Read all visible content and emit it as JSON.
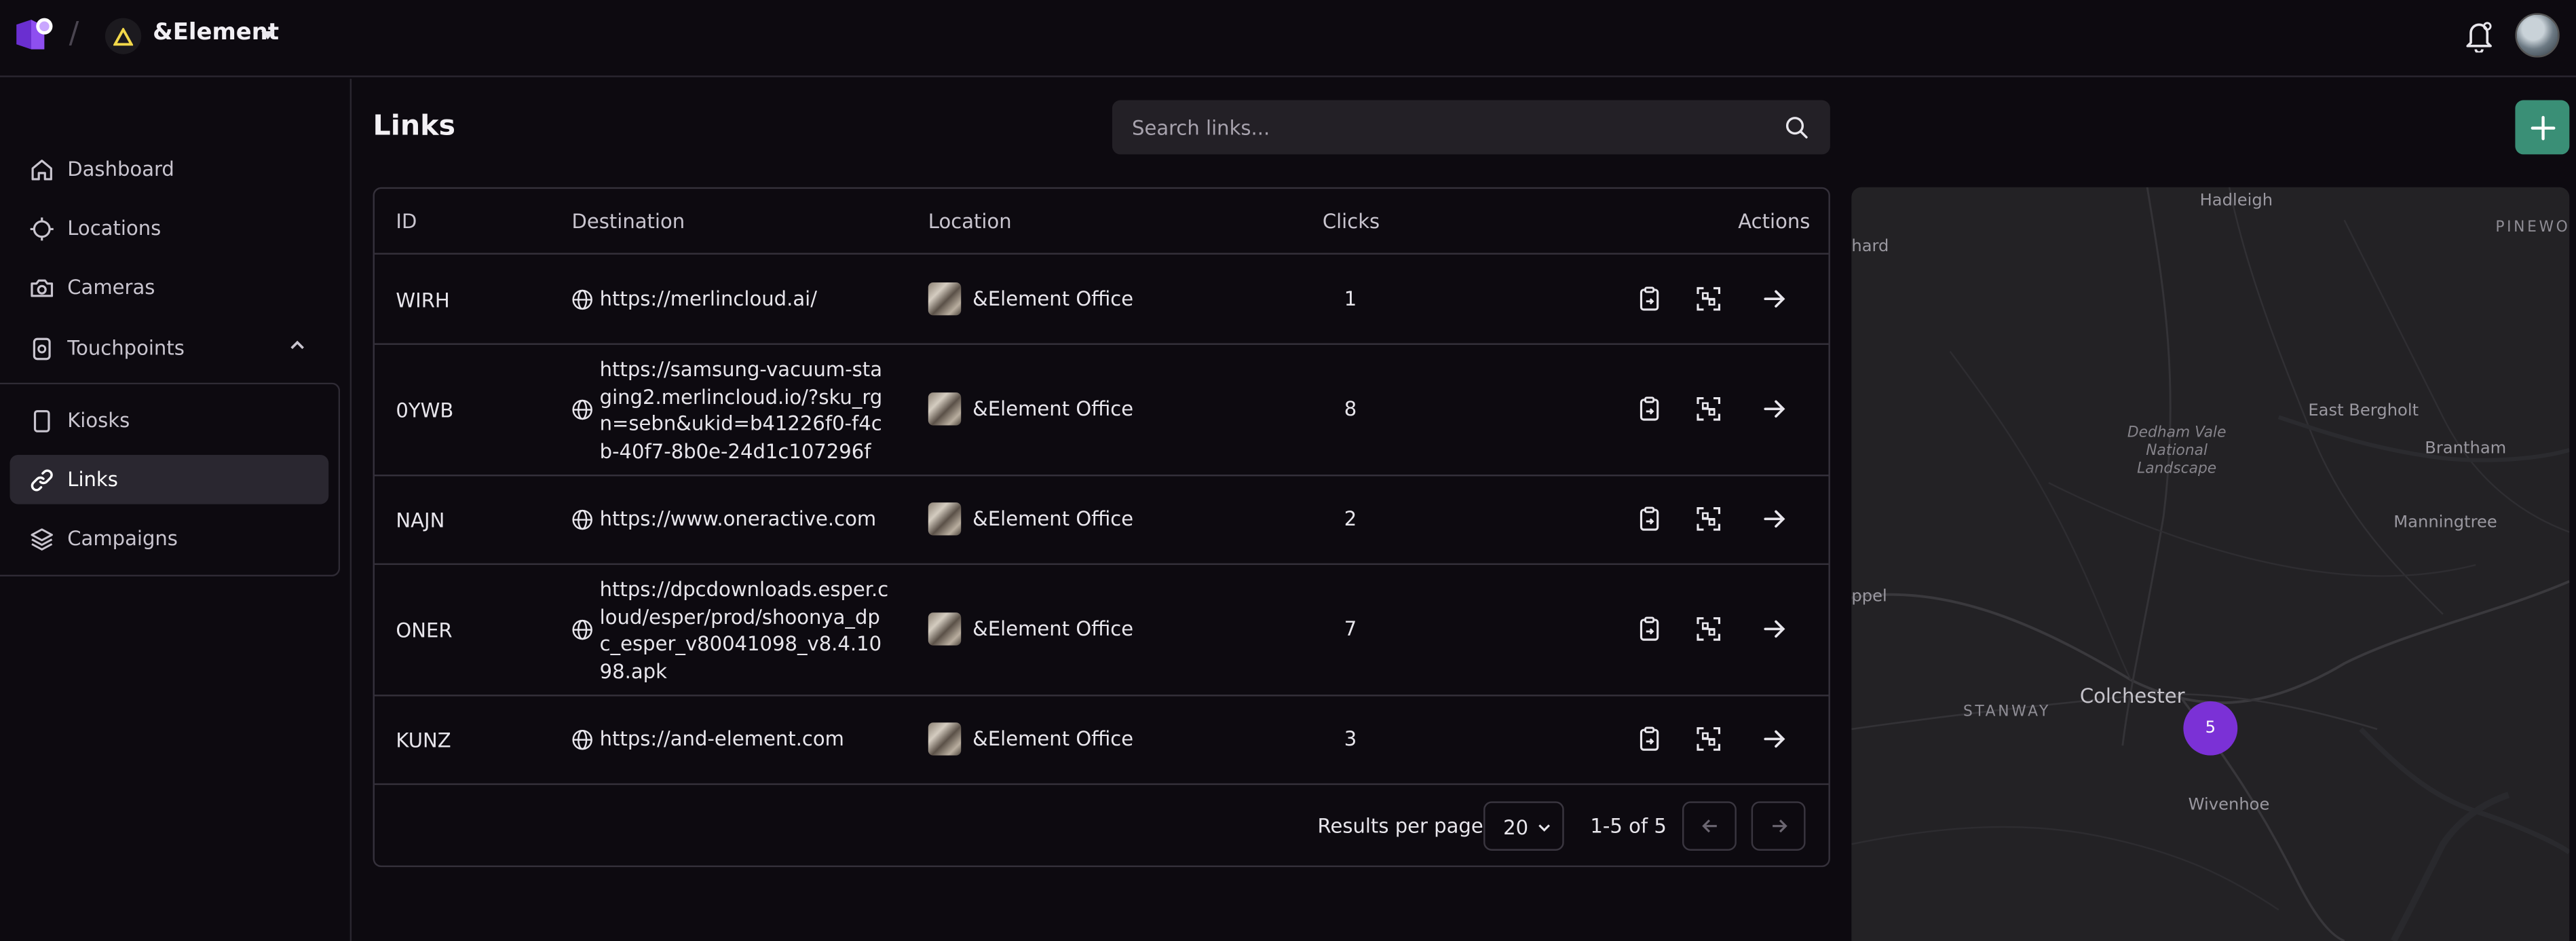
{
  "header": {
    "org_name": "&Element"
  },
  "sidebar": {
    "items": [
      {
        "label": "Dashboard",
        "icon": "home-icon"
      },
      {
        "label": "Locations",
        "icon": "crosshair-icon"
      },
      {
        "label": "Cameras",
        "icon": "camera-icon"
      },
      {
        "label": "Touchpoints",
        "icon": "touchpoint-icon",
        "expanded": true
      }
    ],
    "sub_items": [
      {
        "label": "Kiosks",
        "icon": "tablet-icon"
      },
      {
        "label": "Links",
        "icon": "link-icon",
        "active": true
      },
      {
        "label": "Campaigns",
        "icon": "layers-icon"
      }
    ]
  },
  "page": {
    "title": "Links",
    "search_placeholder": "Search links..."
  },
  "table": {
    "columns": [
      "ID",
      "Destination",
      "Location",
      "Clicks",
      "Actions"
    ],
    "rows": [
      {
        "id": "WIRH",
        "destination": "https://merlincloud.ai/",
        "location": "&Element Office",
        "clicks": "1"
      },
      {
        "id": "0YWB",
        "destination": "https://samsung-vacuum-staging2.merlincloud.io/?sku_rgn=sebn&ukid=b41226f0-f4cb-40f7-8b0e-24d1c107296f",
        "location": "&Element Office",
        "clicks": "8"
      },
      {
        "id": "NAJN",
        "destination": "https://www.oneractive.com",
        "location": "&Element Office",
        "clicks": "2"
      },
      {
        "id": "ONER",
        "destination": "https://dpcdownloads.esper.cloud/esper/prod/shoonya_dpc_esper_v80041098_v8.4.1098.apk",
        "location": "&Element Office",
        "clicks": "7"
      },
      {
        "id": "KUNZ",
        "destination": "https://and-element.com",
        "location": "&Element Office",
        "clicks": "3"
      }
    ],
    "footer": {
      "results_per_page_label": "Results per page",
      "results_per_page_value": "20",
      "range": "1-5 of 5"
    }
  },
  "map": {
    "labels": [
      "Hadleigh",
      "hard",
      "PINEWOO",
      "East Bergholt",
      "Brantham",
      "Dedham Vale National Landscape",
      "Manningtree",
      "ppel",
      "STANWAY",
      "Colchester",
      "Wivenhoe"
    ],
    "cluster_count": "5"
  },
  "colors": {
    "accent_green": "#3a8f76",
    "cluster_purple": "#7b31d6",
    "background": "#0d0a10"
  }
}
